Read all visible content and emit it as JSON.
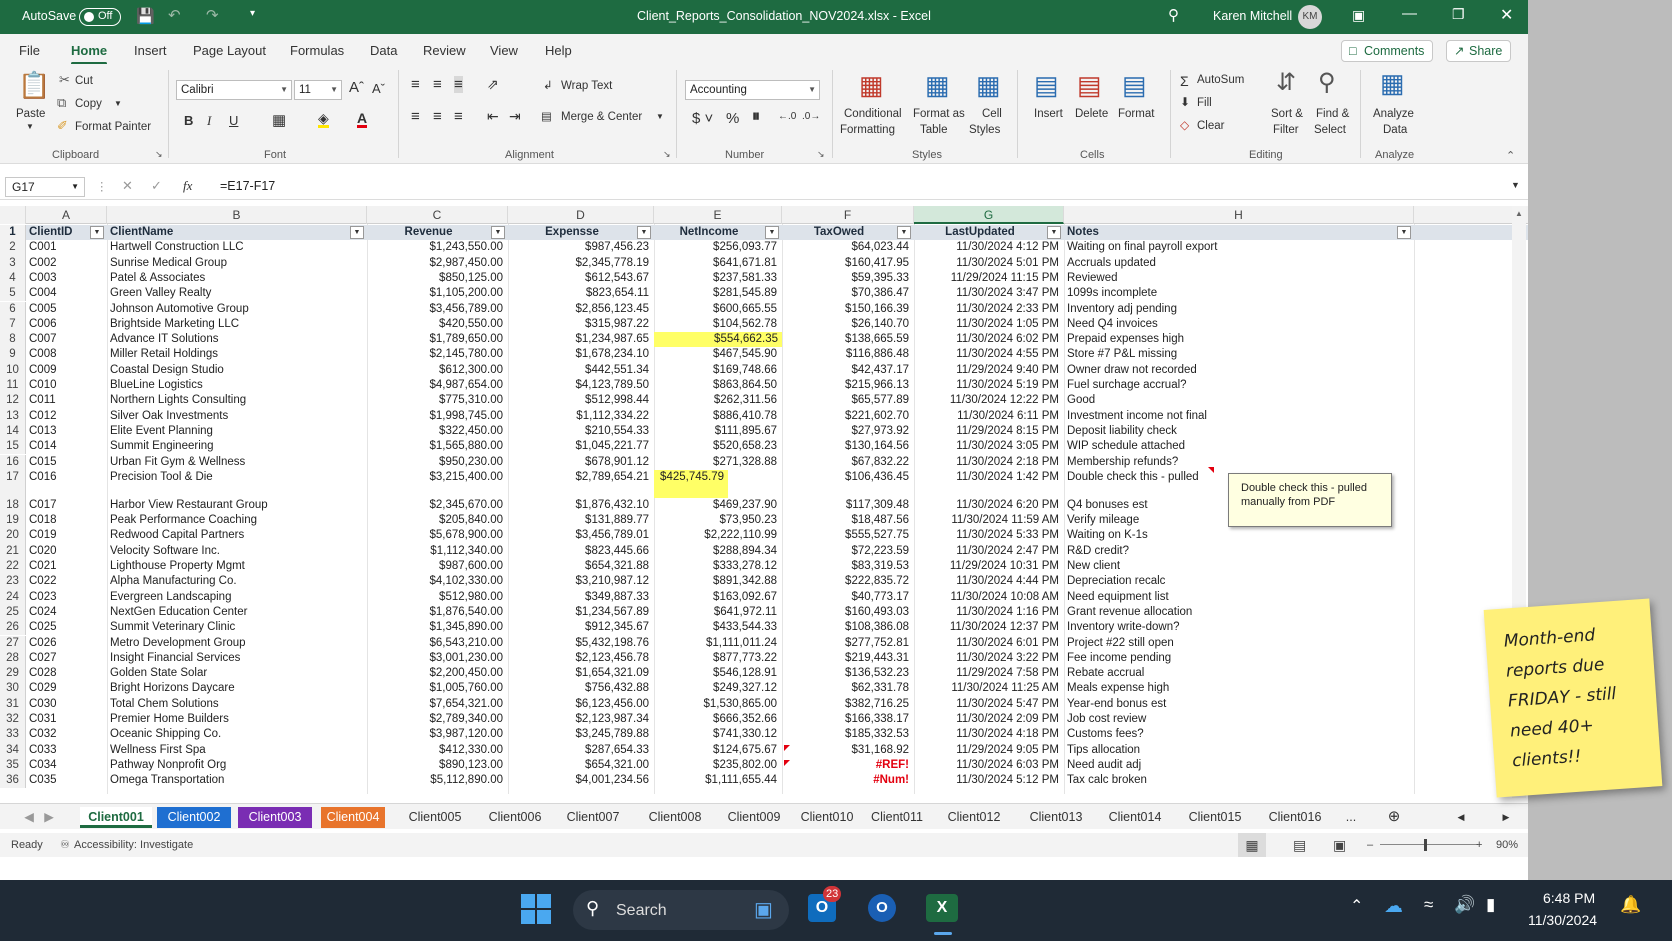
{
  "titlebar": {
    "autosave_label": "AutoSave",
    "autosave_state": "Off",
    "file_title": "Client_Reports_Consolidation_NOV2024.xlsx  -  Excel",
    "user_name": "Karen Mitchell",
    "user_initials": "KM"
  },
  "menu": {
    "items": [
      "File",
      "Home",
      "Insert",
      "Page Layout",
      "Formulas",
      "Data",
      "Review",
      "View",
      "Help"
    ],
    "comments_label": "Comments",
    "share_label": "Share"
  },
  "ribbon": {
    "clipboard": {
      "paste": "Paste",
      "cut": "Cut",
      "copy": "Copy",
      "format_painter": "Format Painter",
      "group": "Clipboard"
    },
    "font": {
      "name": "Calibri",
      "size": "11",
      "group": "Font"
    },
    "alignment": {
      "wrap": "Wrap Text",
      "merge": "Merge & Center",
      "group": "Alignment"
    },
    "number": {
      "format": "Accounting",
      "group": "Number"
    },
    "styles": {
      "conditional": "Conditional",
      "conditional2": "Formatting",
      "format_as": "Format as",
      "format_as2": "Table",
      "cell": "Cell",
      "cell2": "Styles",
      "group": "Styles"
    },
    "cells": {
      "insert": "Insert",
      "delete": "Delete",
      "format": "Format",
      "group": "Cells"
    },
    "editing": {
      "autosum": "AutoSum",
      "fill": "Fill",
      "clear": "Clear",
      "sort": "Sort &",
      "sort2": "Filter",
      "find": "Find &",
      "find2": "Select",
      "group": "Editing"
    },
    "analyze": {
      "label": "Analyze",
      "label2": "Data",
      "group": "Analyze"
    }
  },
  "formula_bar": {
    "name_box": "G17",
    "formula": "=E17-F17"
  },
  "columns": [
    "A",
    "B",
    "C",
    "D",
    "E",
    "F",
    "G",
    "H"
  ],
  "headers": [
    "ClientID",
    "ClientName",
    "Revenue",
    "Expensse",
    "NetIncome",
    "TaxOwed",
    "LastUpdated",
    "Notes"
  ],
  "rows": [
    [
      "2",
      "C001",
      "Hartwell Construction LLC",
      "$1,243,550.00",
      "$987,456.23",
      "$256,093.77",
      "$64,023.44",
      "11/30/2024 4:12 PM",
      "Waiting on final payroll export"
    ],
    [
      "3",
      "C002",
      "Sunrise Medical Group",
      "$2,987,450.00",
      "$2,345,778.19",
      "$641,671.81",
      "$160,417.95",
      "11/30/2024 5:01 PM",
      "Accruals updated"
    ],
    [
      "4",
      "C003",
      "Patel & Associates",
      "$850,125.00",
      "$612,543.67",
      "$237,581.33",
      "$59,395.33",
      "11/29/2024 11:15 PM",
      "Reviewed"
    ],
    [
      "5",
      "C004",
      "Green Valley Realty",
      "$1,105,200.00",
      "$823,654.11",
      "$281,545.89",
      "$70,386.47",
      "11/30/2024 3:47 PM",
      "1099s incomplete"
    ],
    [
      "6",
      "C005",
      "Johnson Automotive Group",
      "$3,456,789.00",
      "$2,856,123.45",
      "$600,665.55",
      "$150,166.39",
      "11/30/2024 2:33 PM",
      "Inventory adj pending"
    ],
    [
      "7",
      "C006",
      "Brightside Marketing LLC",
      "$420,550.00",
      "$315,987.22",
      "$104,562.78",
      "$26,140.70",
      "11/30/2024 1:05 PM",
      "Need Q4 invoices"
    ],
    [
      "8",
      "C007",
      "Advance IT Solutions",
      "$1,789,650.00",
      "$1,234,987.65",
      "$554,662.35",
      "$138,665.59",
      "11/30/2024 6:02 PM",
      "Prepaid expenses high"
    ],
    [
      "9",
      "C008",
      "Miller Retail Holdings",
      "$2,145,780.00",
      "$1,678,234.10",
      "$467,545.90",
      "$116,886.48",
      "11/30/2024 4:55 PM",
      "Store #7 P&L missing"
    ],
    [
      "10",
      "C009",
      "Coastal Design Studio",
      "$612,300.00",
      "$442,551.34",
      "$169,748.66",
      "$42,437.17",
      "11/29/2024 9:40 PM",
      "Owner draw not recorded"
    ],
    [
      "11",
      "C010",
      "BlueLine Logistics",
      "$4,987,654.00",
      "$4,123,789.50",
      "$863,864.50",
      "$215,966.13",
      "11/30/2024 5:19 PM",
      "Fuel surchage accrual?"
    ],
    [
      "12",
      "C011",
      "Northern Lights Consulting",
      "$775,310.00",
      "$512,998.44",
      "$262,311.56",
      "$65,577.89",
      "11/30/2024 12:22 PM",
      "Good"
    ],
    [
      "13",
      "C012",
      "Silver Oak Investments",
      "$1,998,745.00",
      "$1,112,334.22",
      "$886,410.78",
      "$221,602.70",
      "11/30/2024 6:11 PM",
      "Investment income not final"
    ],
    [
      "14",
      "C013",
      "Elite Event Planning",
      "$322,450.00",
      "$210,554.33",
      "$111,895.67",
      "$27,973.92",
      "11/29/2024 8:15 PM",
      "Deposit liability check"
    ],
    [
      "15",
      "C014",
      "Summit Engineering",
      "$1,565,880.00",
      "$1,045,221.77",
      "$520,658.23",
      "$130,164.56",
      "11/30/2024 3:05 PM",
      "WIP schedule attached"
    ],
    [
      "16",
      "C015",
      "Urban Fit Gym & Wellness",
      "$950,230.00",
      "$678,901.12",
      "$271,328.88",
      "$67,832.22",
      "11/30/2024 2:18 PM",
      "Membership refunds?"
    ],
    [
      "17",
      "C016",
      "Precision Tool & Die",
      "$3,215,400.00",
      "$2,789,654.21",
      "$425,745.79",
      "$106,436.45",
      "11/30/2024 1:42 PM",
      "Double check this - pulled"
    ],
    [
      "18",
      "C017",
      "Harbor View Restaurant Group",
      "$2,345,670.00",
      "$1,876,432.10",
      "$469,237.90",
      "$117,309.48",
      "11/30/2024 6:20 PM",
      "Q4 bonuses est"
    ],
    [
      "19",
      "C018",
      "Peak Performance Coaching",
      "$205,840.00",
      "$131,889.77",
      "$73,950.23",
      "$18,487.56",
      "11/30/2024 11:59 AM",
      "Verify mileage"
    ],
    [
      "20",
      "C019",
      "Redwood Capital Partners",
      "$5,678,900.00",
      "$3,456,789.01",
      "$2,222,110.99",
      "$555,527.75",
      "11/30/2024 5:33 PM",
      "Waiting on K-1s"
    ],
    [
      "21",
      "C020",
      "Velocity Software Inc.",
      "$1,112,340.00",
      "$823,445.66",
      "$288,894.34",
      "$72,223.59",
      "11/30/2024 2:47 PM",
      "R&D credit?"
    ],
    [
      "22",
      "C021",
      "Lighthouse Property Mgmt",
      "$987,600.00",
      "$654,321.88",
      "$333,278.12",
      "$83,319.53",
      "11/29/2024 10:31 PM",
      "New client"
    ],
    [
      "23",
      "C022",
      "Alpha Manufacturing Co.",
      "$4,102,330.00",
      "$3,210,987.12",
      "$891,342.88",
      "$222,835.72",
      "11/30/2024 4:44 PM",
      "Depreciation recalc"
    ],
    [
      "24",
      "C023",
      "Evergreen Landscaping",
      "$512,980.00",
      "$349,887.33",
      "$163,092.67",
      "$40,773.17",
      "11/30/2024 10:08 AM",
      "Need equipment list"
    ],
    [
      "25",
      "C024",
      "NextGen Education Center",
      "$1,876,540.00",
      "$1,234,567.89",
      "$641,972.11",
      "$160,493.03",
      "11/30/2024 1:16 PM",
      "Grant revenue allocation"
    ],
    [
      "26",
      "C025",
      "Summit Veterinary Clinic",
      "$1,345,890.00",
      "$912,345.67",
      "$433,544.33",
      "$108,386.08",
      "11/30/2024 12:37 PM",
      "Inventory write-down?"
    ],
    [
      "27",
      "C026",
      "Metro Development Group",
      "$6,543,210.00",
      "$5,432,198.76",
      "$1,111,011.24",
      "$277,752.81",
      "11/30/2024 6:01 PM",
      "Project #22 still open"
    ],
    [
      "28",
      "C027",
      "Insight Financial Services",
      "$3,001,230.00",
      "$2,123,456.78",
      "$877,773.22",
      "$219,443.31",
      "11/30/2024 3:22 PM",
      "Fee income pending"
    ],
    [
      "29",
      "C028",
      "Golden State Solar",
      "$2,200,450.00",
      "$1,654,321.09",
      "$546,128.91",
      "$136,532.23",
      "11/29/2024 7:58 PM",
      "Rebate accrual"
    ],
    [
      "30",
      "C029",
      "Bright Horizons Daycare",
      "$1,005,760.00",
      "$756,432.88",
      "$249,327.12",
      "$62,331.78",
      "11/30/2024 11:25 AM",
      "Meals expense high"
    ],
    [
      "31",
      "C030",
      "Total Chem Solutions",
      "$7,654,321.00",
      "$6,123,456.00",
      "$1,530,865.00",
      "$382,716.25",
      "11/30/2024 5:47 PM",
      "Year-end bonus est"
    ],
    [
      "32",
      "C031",
      "Premier Home Builders",
      "$2,789,340.00",
      "$2,123,987.34",
      "$666,352.66",
      "$166,338.17",
      "11/30/2024 2:09 PM",
      "Job cost review"
    ],
    [
      "33",
      "C032",
      "Oceanic Shipping Co.",
      "$3,987,120.00",
      "$3,245,789.88",
      "$741,330.12",
      "$185,332.53",
      "11/30/2024 4:18 PM",
      "Customs fees?"
    ],
    [
      "34",
      "C033",
      "Wellness First Spa",
      "$412,330.00",
      "$287,654.33",
      "$124,675.67",
      "$31,168.92",
      "11/29/2024 9:05 PM",
      "Tips allocation"
    ],
    [
      "35",
      "C034",
      "Pathway Nonprofit Org",
      "$890,123.00",
      "$654,321.00",
      "$235,802.00",
      "#REF!",
      "11/30/2024 6:03 PM",
      "Need audit adj"
    ],
    [
      "36",
      "C035",
      "Omega Transportation",
      "$5,112,890.00",
      "$4,001,234.56",
      "$1,111,655.44",
      "#Num!",
      "11/30/2024 5:12 PM",
      "Tax calc broken"
    ]
  ],
  "comment_text": "Double check this - pulled manually from PDF",
  "sheet_tabs": [
    "Client001",
    "Client002",
    "Client003",
    "Client004",
    "Client005",
    "Client006",
    "Client007",
    "Client008",
    "Client009",
    "Client010",
    "Client011",
    "Client012",
    "Client013",
    "Client014",
    "Client015",
    "Client016",
    "..."
  ],
  "tab_colors": {
    "Client001": "#1e6b41",
    "Client002": "#1f6fd1",
    "Client003": "#7a2db3",
    "Client004": "#e8742c"
  },
  "status": {
    "ready": "Ready",
    "accessibility": "Accessibility: Investigate",
    "zoom": "90%"
  },
  "sticky_note": "Month-end reports due FRIDAY - still need 40+ clients!!",
  "taskbar": {
    "search": "Search",
    "badge": "23",
    "time": "6:48 PM",
    "date": "11/30/2024"
  }
}
